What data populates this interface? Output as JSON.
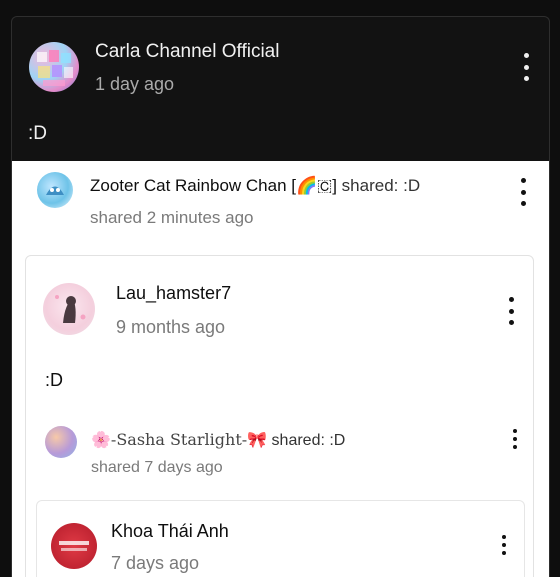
{
  "main_post": {
    "channel_name": "Carla Channel Official",
    "time": "1 day ago",
    "text": ":D",
    "menu_icon": "more-vert-icon"
  },
  "share_1": {
    "name": "Zooter Cat Rainbow Chan [🌈🇨]",
    "action": "shared: :D",
    "time": "shared 2 minutes ago",
    "menu_icon": "more-vert-icon"
  },
  "original_post": {
    "name": "Lau_hamster7",
    "time": "9 months ago",
    "text": ":D",
    "menu_icon": "more-vert-icon"
  },
  "share_2": {
    "name": "🌸-Sasha Starlight-🎀",
    "action": "shared: :D",
    "time": "shared 7 days ago",
    "menu_icon": "more-vert-icon"
  },
  "nested_post": {
    "name": "Khoa Thái Anh",
    "time": "7 days ago",
    "menu_icon": "more-vert-icon"
  }
}
